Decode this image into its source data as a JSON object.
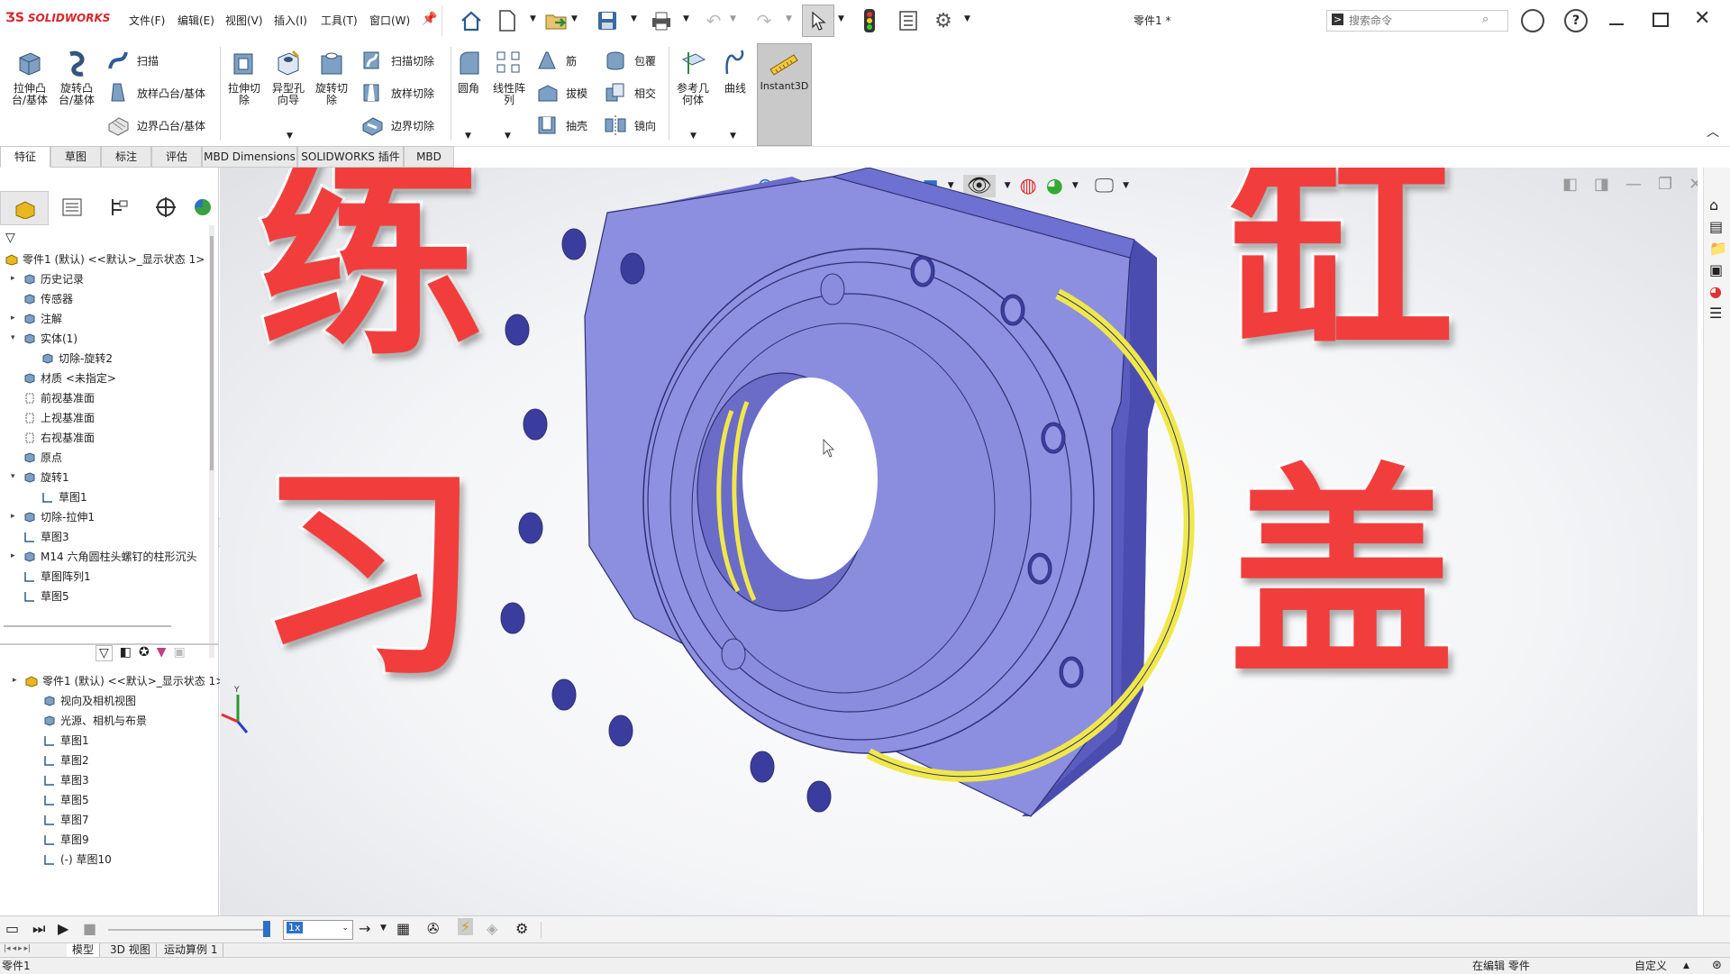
{
  "app": {
    "logo": "SOLIDWORKS",
    "document_title": "零件1 *",
    "search_placeholder": "搜索命令"
  },
  "menu": [
    "文件(F)",
    "编辑(E)",
    "视图(V)",
    "插入(I)",
    "工具(T)",
    "窗口(W)"
  ],
  "ribbon": {
    "extrude_boss": [
      "拉伸凸",
      "台/基体"
    ],
    "revolve_boss": [
      "旋转凸",
      "台/基体"
    ],
    "sweep": "扫描",
    "loft": "放样凸台/基体",
    "boundary_boss": "边界凸台/基体",
    "extrude_cut": [
      "拉伸切",
      "除"
    ],
    "hole_wizard": [
      "异型孔",
      "向导"
    ],
    "revolve_cut": [
      "旋转切",
      "除"
    ],
    "sweep_cut": "扫描切除",
    "loft_cut": "放样切除",
    "boundary_cut": "边界切除",
    "fillet": "圆角",
    "linear_pattern": [
      "线性阵",
      "列"
    ],
    "rib": "筋",
    "wrap": "包覆",
    "draft": "拔模",
    "intersect": "相交",
    "shell": "抽壳",
    "mirror": "镜向",
    "ref_geometry": [
      "参考几",
      "何体"
    ],
    "curves": "曲线",
    "instant3d": "Instant3D"
  },
  "tabs": [
    "特征",
    "草图",
    "标注",
    "评估",
    "MBD Dimensions",
    "SOLIDWORKS 插件",
    "MBD"
  ],
  "feature_tree": [
    {
      "label": "零件1 (默认) <<默认>_显示状态 1>",
      "indent": 0
    },
    {
      "label": "历史记录",
      "indent": 1,
      "expander": true
    },
    {
      "label": "传感器",
      "indent": 1
    },
    {
      "label": "注解",
      "indent": 1,
      "expander": true
    },
    {
      "label": "实体(1)",
      "indent": 1,
      "expander": true
    },
    {
      "label": "切除-旋转2",
      "indent": 2
    },
    {
      "label": "材质 <未指定>",
      "indent": 1
    },
    {
      "label": "前视基准面",
      "indent": 1
    },
    {
      "label": "上视基准面",
      "indent": 1
    },
    {
      "label": "右视基准面",
      "indent": 1
    },
    {
      "label": "原点",
      "indent": 1
    },
    {
      "label": "旋转1",
      "indent": 1,
      "expander": true
    },
    {
      "label": "草图1",
      "indent": 2
    },
    {
      "label": "切除-拉伸1",
      "indent": 1,
      "expander": true
    },
    {
      "label": "草图3",
      "indent": 1
    },
    {
      "label": "M14 六角圆柱头螺钉的柱形沉头",
      "indent": 1,
      "expander": true
    },
    {
      "label": "草图阵列1",
      "indent": 1
    },
    {
      "label": "草图5",
      "indent": 1
    }
  ],
  "display_tree": [
    {
      "label": "零件1 (默认) <<默认>_显示状态 1>",
      "indent": 0
    },
    {
      "label": "视向及相机视图",
      "indent": 1
    },
    {
      "label": "光源、相机与布景",
      "indent": 1
    },
    {
      "label": "草图1",
      "indent": 1
    },
    {
      "label": "草图2",
      "indent": 1
    },
    {
      "label": "草图3",
      "indent": 1
    },
    {
      "label": "草图5",
      "indent": 1
    },
    {
      "label": "草图7",
      "indent": 1
    },
    {
      "label": "草图9",
      "indent": 1
    },
    {
      "label": "(-) 草图10",
      "indent": 1
    }
  ],
  "overlay_text": {
    "left_top": "练",
    "left_bottom": "习",
    "right_top": "缸",
    "right_bottom": "盖"
  },
  "colors": {
    "part_face": "#8c8ee0",
    "part_side": "#5a5cc0",
    "part_hole": "#3b3d9e",
    "highlight_edge": "#f0e84a",
    "overlay_text": "#f23d3d"
  },
  "playback": {
    "speed": "1x"
  },
  "model_tabs": [
    "模型",
    "3D 视图",
    "运动算例 1"
  ],
  "status": {
    "left": "零件1",
    "mode": "在编辑 零件",
    "units": "自定义"
  },
  "triad_label": "Y"
}
